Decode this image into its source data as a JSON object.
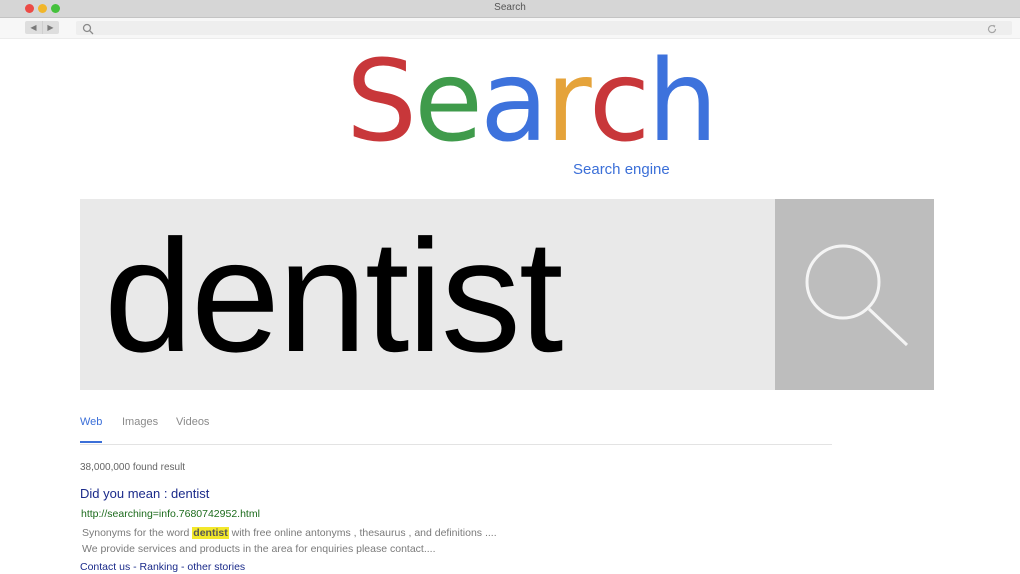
{
  "window": {
    "title": "Search"
  },
  "toolbar": {
    "back_icon": "arrow-left-icon",
    "forward_icon": "arrow-right-icon",
    "search_icon": "magnifier-icon",
    "reload_icon": "reload-icon"
  },
  "logo": {
    "letters": [
      {
        "char": "S",
        "color": "#c8373a"
      },
      {
        "char": "e",
        "color": "#3f9b4b"
      },
      {
        "char": "a",
        "color": "#3d72dc"
      },
      {
        "char": "r",
        "color": "#e5a33a"
      },
      {
        "char": "c",
        "color": "#c8373a"
      },
      {
        "char": "h",
        "color": "#3d72dc"
      }
    ],
    "subtitle": "Search engine"
  },
  "search": {
    "query": "dentist",
    "button_icon": "magnifier-icon"
  },
  "tabs": [
    {
      "label": "Web",
      "active": true
    },
    {
      "label": "Images",
      "active": false
    },
    {
      "label": "Videos",
      "active": false
    }
  ],
  "results": {
    "count": "38,000,000 found result",
    "did_you_mean": "Did you mean : dentist",
    "url": "http://searching=info.7680742952.html",
    "snippet_before": "Synonyms for the word ",
    "snippet_highlight": "dentist",
    "snippet_after": " with free online antonyms , thesaurus , and definitions ....",
    "snippet_line2": "We provide services and products in the area for enquiries please contact....",
    "links": "Contact us - Ranking - other stories"
  },
  "colors": {
    "accent_blue": "#3b6fd8",
    "highlight": "#f3e82a"
  }
}
